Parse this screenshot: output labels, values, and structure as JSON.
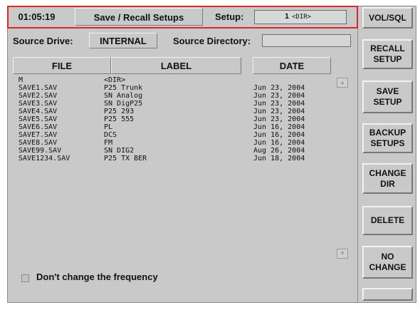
{
  "header": {
    "time": "01:05:19",
    "title": "Save / Recall Setups",
    "setup_label": "Setup:",
    "setup_number": "1",
    "setup_dir": "<DIR>"
  },
  "source": {
    "drive_label": "Source Drive:",
    "drive_value": "INTERNAL",
    "directory_label": "Source Directory:",
    "directory_value": ""
  },
  "columns": {
    "file": "FILE",
    "label": "LABEL",
    "date": "DATE"
  },
  "files": [
    {
      "file": "M",
      "label": "<DIR>",
      "date": ""
    },
    {
      "file": "SAVE1.SAV",
      "label": "P25 Trunk",
      "date": "Jun 23, 2004"
    },
    {
      "file": "SAVE2.SAV",
      "label": "SN Analog",
      "date": "Jun 23, 2004"
    },
    {
      "file": "SAVE3.SAV",
      "label": "SN DigP25",
      "date": "Jun 23, 2004"
    },
    {
      "file": "SAVE4.SAV",
      "label": "P25 293",
      "date": "Jun 23, 2004"
    },
    {
      "file": "SAVE5.SAV",
      "label": "P25 555",
      "date": "Jun 23, 2004"
    },
    {
      "file": "SAVE6.SAV",
      "label": "PL",
      "date": "Jun 16, 2004"
    },
    {
      "file": "SAVE7.SAV",
      "label": "DCS",
      "date": "Jun 16, 2004"
    },
    {
      "file": "SAVE8.SAV",
      "label": "FM",
      "date": "Jun 16, 2004"
    },
    {
      "file": "SAVE99.SAV",
      "label": "SN DIG2",
      "date": "Aug 26, 2004"
    },
    {
      "file": "SAVE1234.SAV",
      "label": "P25 TX BER",
      "date": "Jun 18, 2004"
    }
  ],
  "checkbox": {
    "label": "Don't change the frequency",
    "checked": false
  },
  "sidebar": {
    "vol_sql": "VOL/SQL",
    "recall": "RECALL SETUP",
    "save": "SAVE SETUP",
    "backup": "BACKUP SETUPS",
    "change_dir": "CHANGE DIR",
    "delete": "DELETE",
    "no_change": "NO CHANGE",
    "blank": ""
  },
  "colors": {
    "highlight_border": "#d62a2a",
    "panel": "#c9c9c9"
  }
}
